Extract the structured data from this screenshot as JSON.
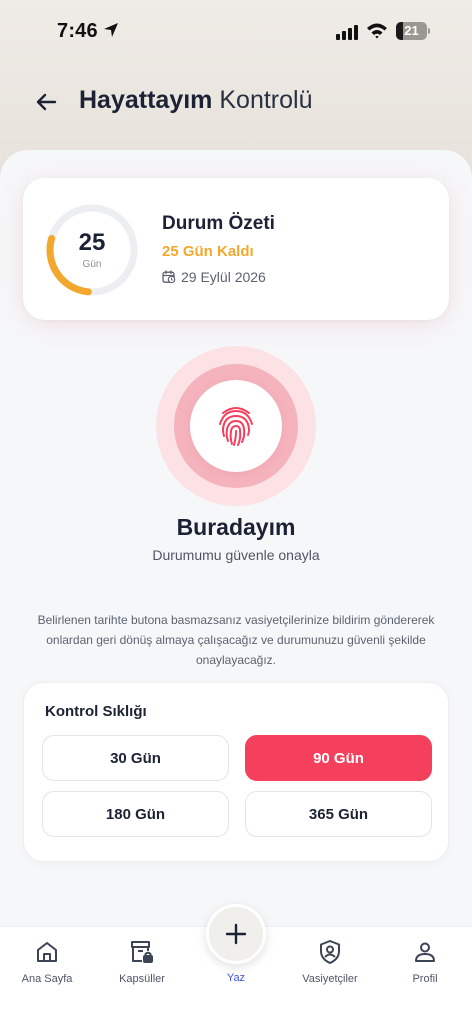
{
  "status_bar": {
    "time": "7:46",
    "battery": "21",
    "battery_level": 0.21
  },
  "header": {
    "title_bold": "Hayattayım",
    "title_light": "Kontrolü"
  },
  "summary": {
    "days_value": "25",
    "days_unit": "Gün",
    "progress_fraction": 0.28,
    "title": "Durum Özeti",
    "remaining": "25 Gün Kaldı",
    "date": "29 Eylül 2026",
    "colors": {
      "accent": "#f2a82c",
      "track": "#eceef2"
    }
  },
  "checkin": {
    "title": "Buradayım",
    "subtitle": "Durumumu güvenle onayla",
    "info": "Belirlenen tarihte butona basmazsanız vasiyetçilerinize bildirim göndererek onlardan geri dönüş almaya çalışacağız ve durumunuzu güvenli şekilde onaylayacağız.",
    "colors": {
      "primary": "#f4405c"
    }
  },
  "frequency": {
    "title": "Kontrol Sıklığı",
    "options": [
      "30 Gün",
      "90 Gün",
      "180 Gün",
      "365 Gün"
    ],
    "selected": "90 Gün"
  },
  "bottom_nav": {
    "items": [
      {
        "label": "Ana Sayfa",
        "icon": "home-icon"
      },
      {
        "label": "Kapsüller",
        "icon": "capsule-icon"
      },
      {
        "label": "Yaz",
        "icon": "plus-icon"
      },
      {
        "label": "Vasiyetçiler",
        "icon": "shield-user-icon"
      },
      {
        "label": "Profil",
        "icon": "user-icon"
      }
    ],
    "active": "Yaz",
    "colors": {
      "active": "#3b56d6"
    }
  }
}
